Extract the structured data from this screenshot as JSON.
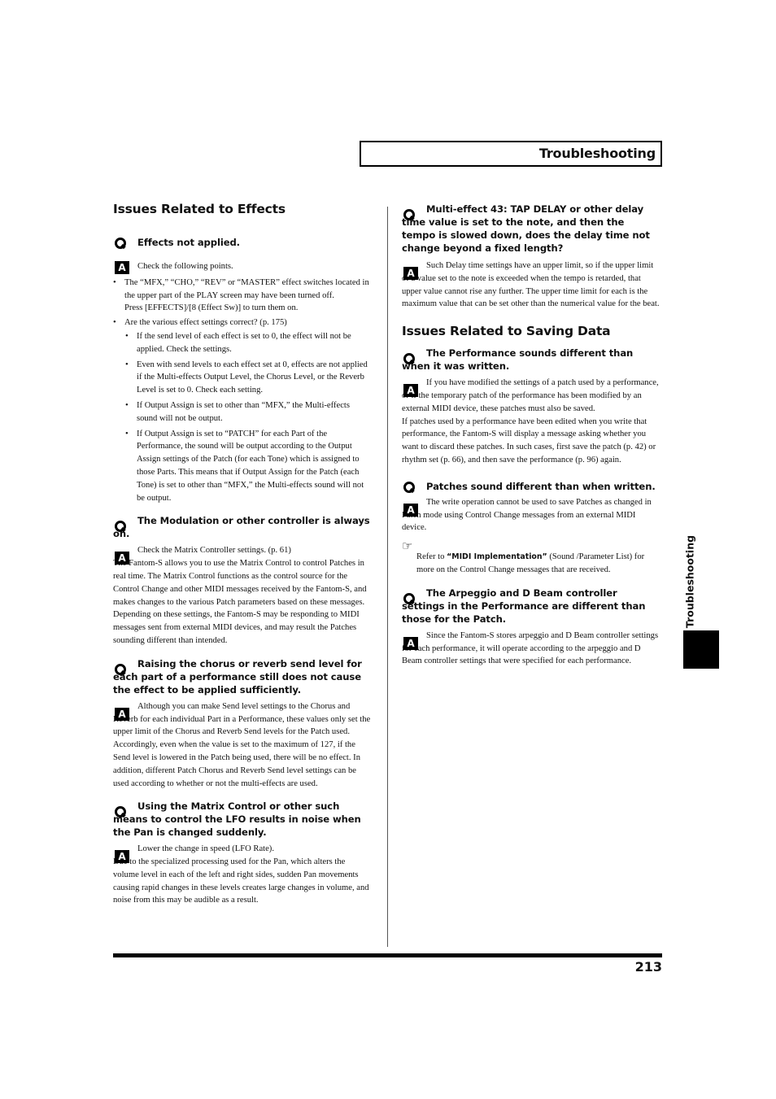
{
  "header": {
    "title": "Troubleshooting"
  },
  "side_tab": {
    "label": "Troubleshooting"
  },
  "footer": {
    "page_number": "213"
  },
  "left_column": {
    "section_title": "Issues Related to Effects",
    "qa": [
      {
        "question": "Effects not applied.",
        "answer": "Check the following points.",
        "bullets": [
          {
            "text": "The “MFX,” “CHO,” “REV” or “MASTER” effect switches located in the upper part of the PLAY screen may have been turned off.",
            "text2": "Press [EFFECTS]/[8 (Effect Sw)] to turn them on."
          },
          {
            "text": "Are the various effect settings correct? (p. 175)",
            "sub": [
              "If the send level of each effect is set to 0, the effect will not be applied. Check the settings.",
              "Even with send levels to each effect set at 0, effects are not applied if the Multi-effects Output Level, the Chorus Level, or the Reverb Level is set to 0. Check each setting.",
              "If Output Assign is set to other than “MFX,” the Multi-effects sound will not be output.",
              "If Output Assign is set to “PATCH” for each Part of the Performance, the sound will be output according to the Output Assign settings of the Patch (for each Tone) which is assigned to those Parts. This means that if Output Assign for the Patch (each Tone) is set to other than “MFX,” the Multi-effects sound will not be output."
            ]
          }
        ]
      },
      {
        "question": "The Modulation or other controller is always on.",
        "answer": "Check the Matrix Controller settings. (p. 61)",
        "answer_cont": "The Fantom-S allows you to use the Matrix Control to control Patches in real time. The Matrix Control functions as the control source for the Control Change and other MIDI messages received by the Fantom-S, and makes changes to the various Patch parameters based on these messages.",
        "extra": "Depending on these settings, the Fantom-S may be responding to MIDI messages sent from external MIDI devices, and may result the Patches sounding different than intended."
      },
      {
        "question": "Raising the chorus or reverb send level for each part of a performance still does not cause the effect to be applied sufficiently.",
        "answer": "Although you can make Send level settings to the Chorus and Reverb for each individual Part in a Performance, these values only set the upper limit of the Chorus and Reverb Send levels for the Patch used. Accordingly, even when the value is set to the maximum of 127, if the Send level is lowered in the Patch being used, there will be no effect. In addition, different Patch Chorus and Reverb Send level settings can be used according to whether or not the multi-effects are used."
      },
      {
        "question": "Using the Matrix Control or other such means to control the LFO results in noise when the Pan is changed suddenly.",
        "answer": "Lower the change in speed (LFO Rate).",
        "answer_cont": "Due to the specialized processing used for the Pan, which alters the volume level in each of the left and right sides, sudden Pan movements causing rapid changes in these levels creates large changes in volume, and noise from this may be audible as a result."
      }
    ]
  },
  "right_column": {
    "top_qa": {
      "question": "Multi-effect 43: TAP DELAY or other delay time value is set to the note, and then the tempo is slowed down, does the delay time not change beyond a fixed length?",
      "answer": "Such Delay time settings have an upper limit, so if the upper limit of a value set to the note is exceeded when the tempo is retarded, that upper value cannot rise any further. The upper time limit for each is the maximum value that can be set other than the numerical value for the beat."
    },
    "section_title": "Issues Related to Saving Data",
    "qa": [
      {
        "question": "The Performance sounds different than when it was written.",
        "answer": "If you have modified the settings of a patch used by a performance, or if the temporary patch of the performance has been modified by an external MIDI device, these patches must also be saved.",
        "extra": "If patches used by a performance have been edited when you write that performance, the Fantom-S will display a message asking whether you want to discard these patches. In such cases, first save the patch (p. 42) or rhythm set (p. 66), and then save the performance (p. 96) again."
      },
      {
        "question": "Patches sound different than when written.",
        "answer": "The write operation cannot be used to save Patches as changed in Patch mode using Control Change messages from an external MIDI device.",
        "reference": {
          "icon": "pointing-hand-icon",
          "prefix": "Refer to ",
          "link": "“MIDI Implementation”",
          "suffix": " (Sound /Parameter List) for more on the Control Change messages that are received."
        }
      },
      {
        "question": "The Arpeggio and D Beam controller settings in the Performance are different than those for the Patch.",
        "answer": "Since the Fantom-S stores arpeggio and D Beam controller settings for each performance, it will operate according to the arpeggio and D Beam controller settings that were specified for each performance."
      }
    ]
  }
}
